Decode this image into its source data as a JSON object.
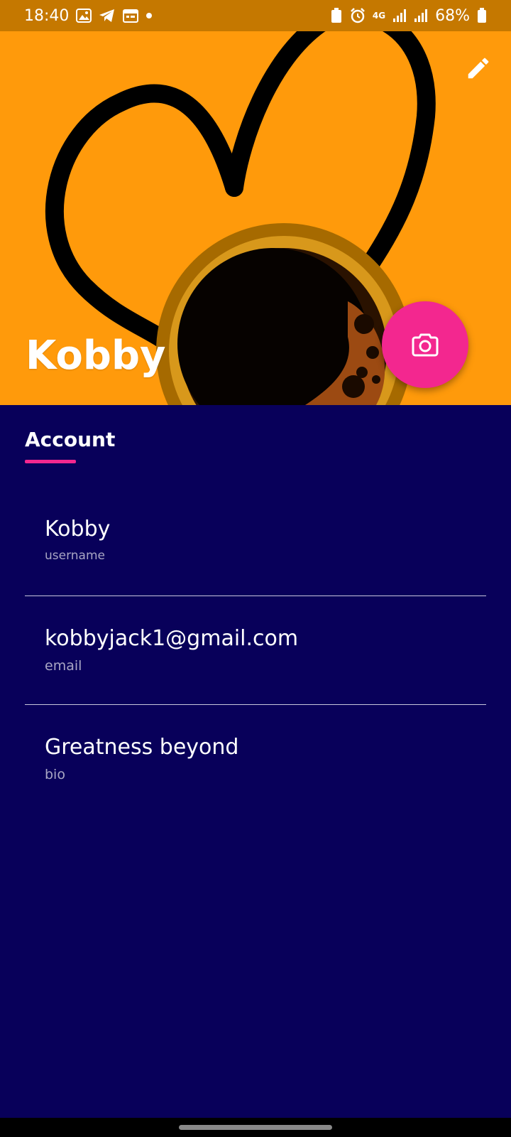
{
  "status_bar": {
    "time": "18:40",
    "network": "4G",
    "battery": "68%"
  },
  "header": {
    "name": "Kobby",
    "edit_icon": "pencil-icon",
    "camera_icon": "camera-icon"
  },
  "section": {
    "title": "Account"
  },
  "fields": [
    {
      "value": "Kobby",
      "label": "username"
    },
    {
      "value": "kobbyjack1@gmail.com",
      "label": "email"
    },
    {
      "value": "Greatness beyond",
      "label": "bio"
    }
  ],
  "colors": {
    "accent": "#f3278f",
    "background": "#08005a",
    "header_bg": "#ff9a0b"
  }
}
